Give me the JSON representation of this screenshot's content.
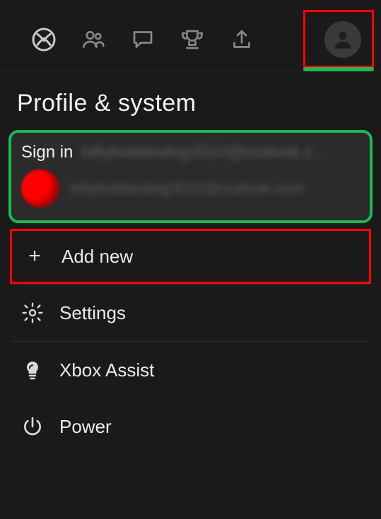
{
  "topbar": {
    "tabs": [
      "xbox",
      "friends",
      "chat",
      "achievements",
      "upload",
      "profile"
    ],
    "active": "profile"
  },
  "page": {
    "title": "Profile & system"
  },
  "account": {
    "signin_label": "Sign in",
    "signin_masked": "billybobbiodog3010@outlook.c...",
    "email_masked": "billybobbiodog3010@outlook.com"
  },
  "menu": {
    "add_new": "Add new",
    "settings": "Settings",
    "xbox_assist": "Xbox Assist",
    "power": "Power"
  },
  "highlights": {
    "profile_tab_box": "red",
    "account_card_border": "green",
    "add_new_box": "red"
  }
}
